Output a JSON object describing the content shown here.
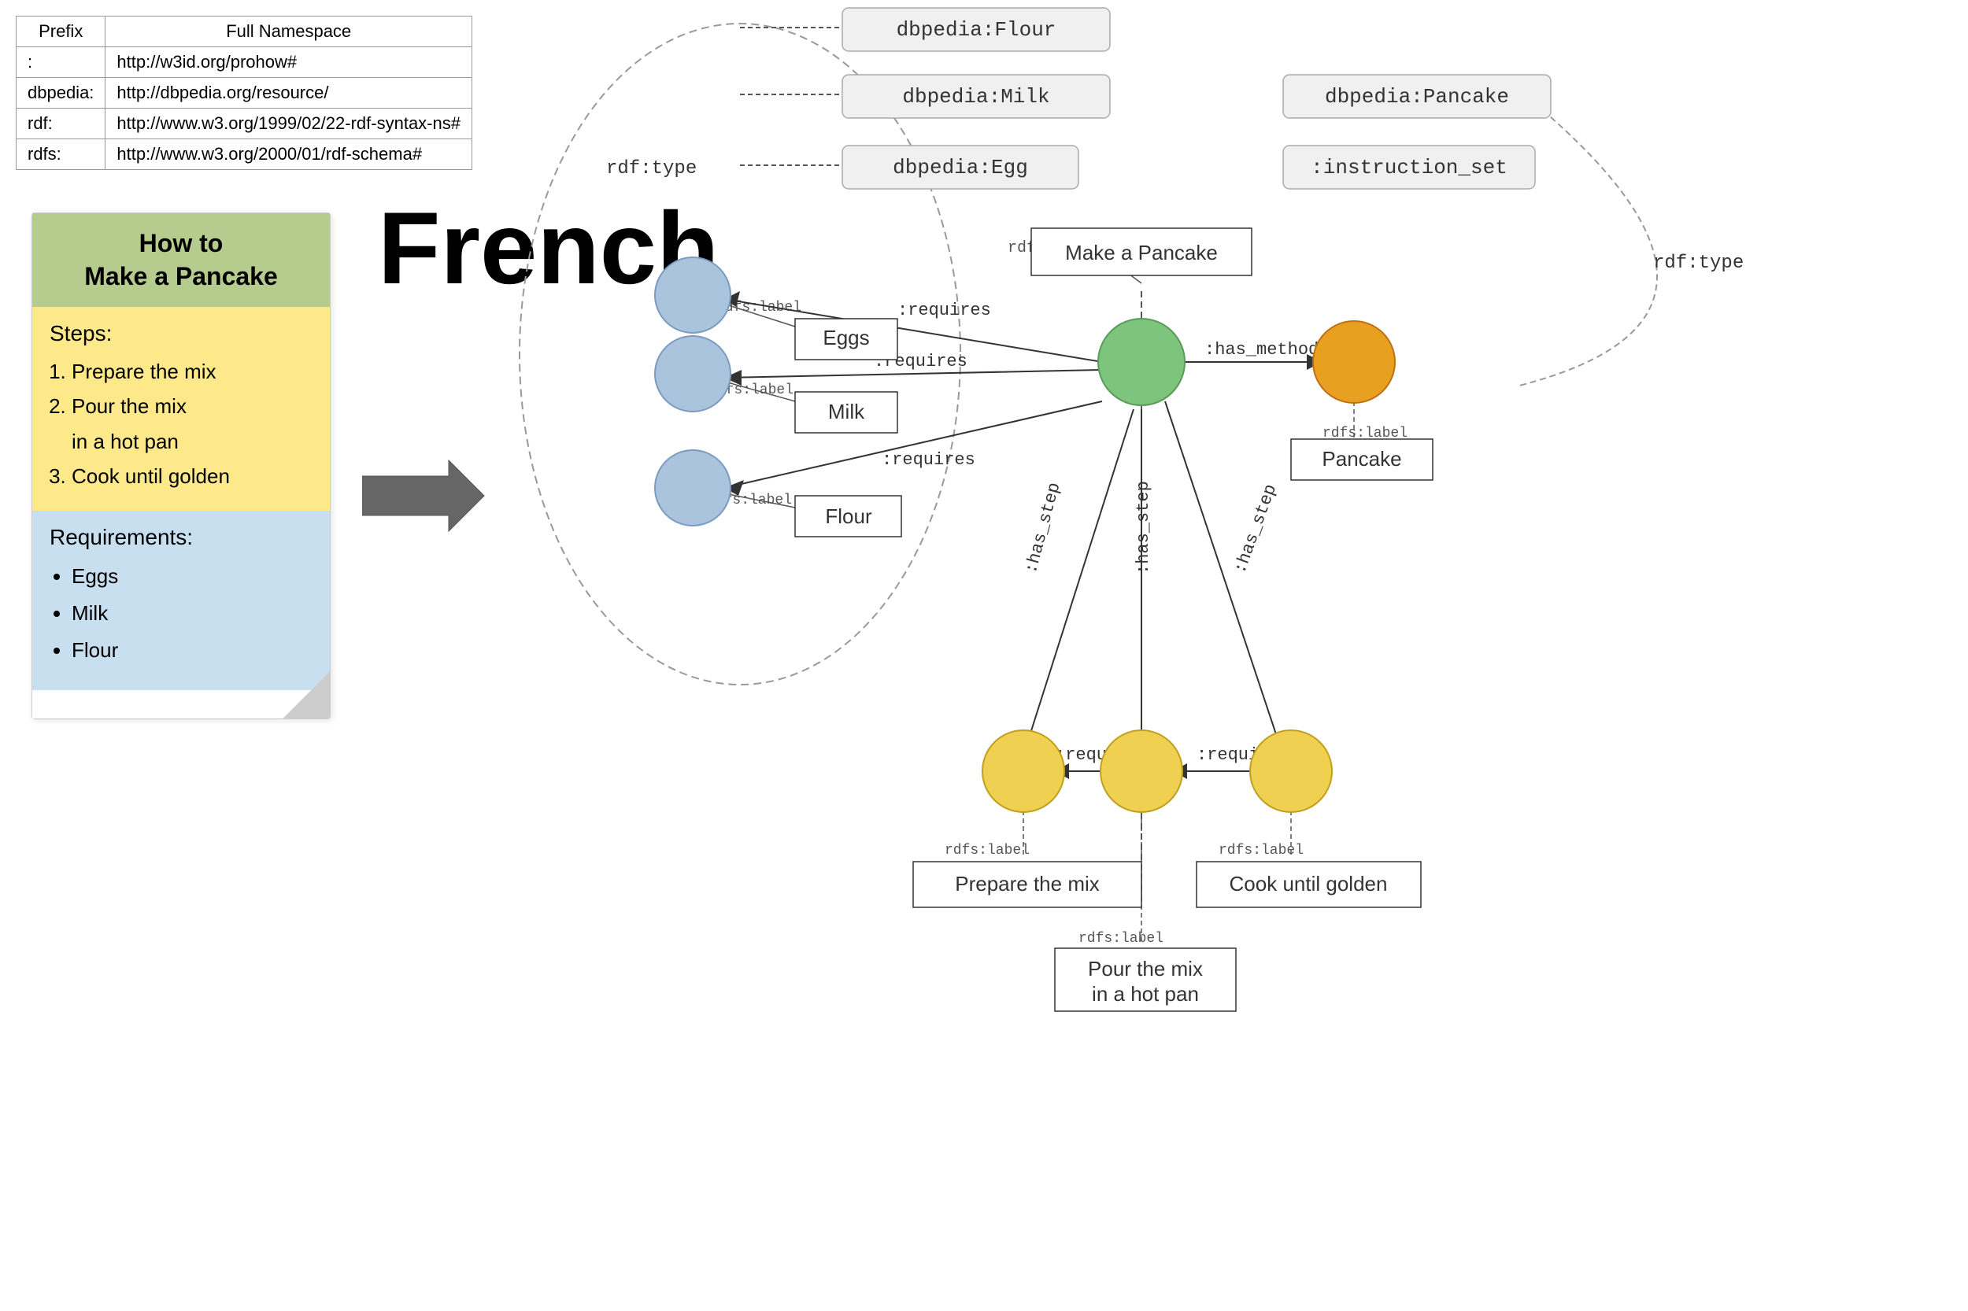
{
  "ns_table": {
    "headers": [
      "Prefix",
      "Full Namespace"
    ],
    "rows": [
      [
        ":",
        "http://w3id.org/prohow#"
      ],
      [
        "dbpedia:",
        "http://dbpedia.org/resource/"
      ],
      [
        "rdf:",
        "http://www.w3.org/1999/02/22-rdf-syntax-ns#"
      ],
      [
        "rdfs:",
        "http://www.w3.org/2000/01/rdf-schema#"
      ]
    ]
  },
  "recipe_card": {
    "title_line1": "How to",
    "title_line2": "Make a Pancake",
    "steps_label": "Steps:",
    "steps": [
      "Prepare the mix",
      "Pour the mix\nin a hot pan",
      "Cook until golden"
    ],
    "reqs_label": "Requirements:",
    "reqs": [
      "Eggs",
      "Milk",
      "Flour"
    ]
  },
  "main_heading": "French",
  "graph": {
    "nodes": {
      "flour_ns": "dbpedia:Flour",
      "milk_ns": "dbpedia:Milk",
      "pancake_ns": "dbpedia:Pancake",
      "egg_ns": "dbpedia:Egg",
      "instruction_set_ns": ":instruction_set",
      "make_pancake_label": "Make a Pancake",
      "eggs_label": "Eggs",
      "milk_label": "Milk",
      "flour_label": "Flour",
      "prepare_label": "Prepare the mix",
      "pour_label": "Pour the mix\nin a hot pan",
      "cook_label": "Cook until golden",
      "pancake_label": "Pancake"
    },
    "edge_labels": {
      "rdf_type_left": "rdf:type",
      "rdf_type_right": "rdf:type",
      "rdfs_label_make": "rdfs:label",
      "rdfs_label_eggs": "rdfs:label",
      "rdfs_label_milk": "rdfs:label",
      "rdfs_label_flour": "rdfs:label",
      "rdfs_label_pancake": "rdfs:label",
      "rdfs_label_prepare": "rdfs:label",
      "rdfs_label_pour": "rdfs:label",
      "rdfs_label_cook": "rdfs:label",
      "requires_eggs": ":requires",
      "requires_milk": ":requires",
      "requires_flour_step": ":requires",
      "requires_prepare": ":requires",
      "has_method": ":has_method",
      "has_step1": ":has_step",
      "has_step2": ":has_step",
      "has_step3": ":has_step"
    }
  }
}
